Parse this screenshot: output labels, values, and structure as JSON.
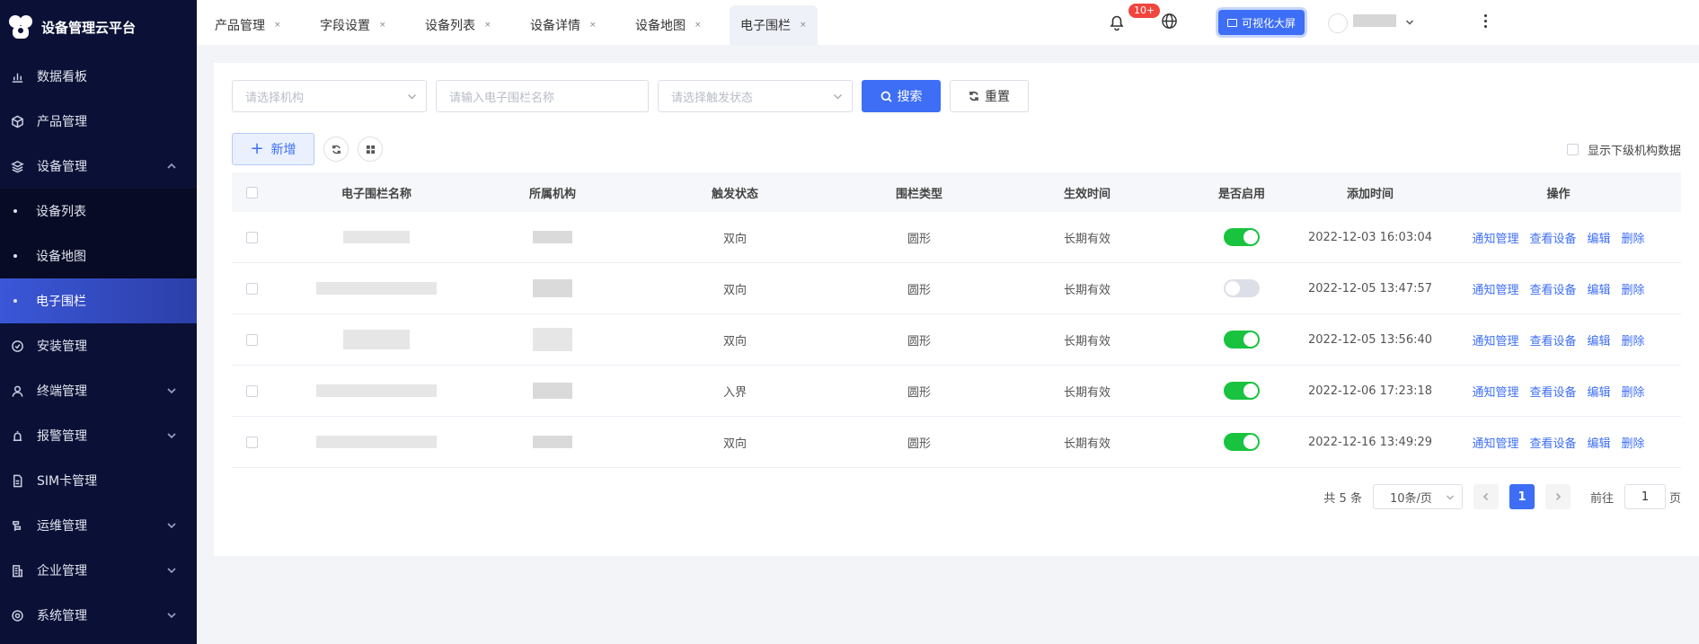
{
  "app": {
    "title": "设备管理云平台"
  },
  "sidebar": {
    "items": [
      {
        "label": "数据看板",
        "icon": "bar-chart-icon",
        "expandable": false
      },
      {
        "label": "产品管理",
        "icon": "cube-icon",
        "expandable": false
      },
      {
        "label": "设备管理",
        "icon": "layers-icon",
        "expandable": true,
        "expanded": true,
        "children": [
          {
            "label": "设备列表",
            "active": false
          },
          {
            "label": "设备地图",
            "active": false
          },
          {
            "label": "电子围栏",
            "active": true
          }
        ]
      },
      {
        "label": "安装管理",
        "icon": "check-circle-icon",
        "expandable": false
      },
      {
        "label": "终端管理",
        "icon": "user-icon",
        "expandable": true
      },
      {
        "label": "报警管理",
        "icon": "alarm-icon",
        "expandable": true
      },
      {
        "label": "SIM卡管理",
        "icon": "sim-card-icon",
        "expandable": false
      },
      {
        "label": "运维管理",
        "icon": "tool-icon",
        "expandable": true
      },
      {
        "label": "企业管理",
        "icon": "building-icon",
        "expandable": true
      },
      {
        "label": "系统管理",
        "icon": "gear-icon",
        "expandable": true
      }
    ]
  },
  "tabs": [
    {
      "label": "产品管理",
      "active": false
    },
    {
      "label": "字段设置",
      "active": false
    },
    {
      "label": "设备列表",
      "active": false
    },
    {
      "label": "设备详情",
      "active": false
    },
    {
      "label": "设备地图",
      "active": false
    },
    {
      "label": "电子围栏",
      "active": true
    }
  ],
  "tab_close_glyph": "×",
  "header": {
    "notification_badge": "10+",
    "bigscreen_label": "可视化大屏"
  },
  "filters": {
    "org_placeholder": "请选择机构",
    "name_placeholder": "请输入电子围栏名称",
    "trigger_placeholder": "请选择触发状态",
    "search_label": "搜索",
    "reset_label": "重置"
  },
  "actions": {
    "add_label": "新增",
    "show_sub_org_label": "显示下级机构数据"
  },
  "table": {
    "columns": [
      "电子围栏名称",
      "所属机构",
      "触发状态",
      "围栏类型",
      "生效时间",
      "是否启用",
      "添加时间",
      "操作"
    ],
    "rows": [
      {
        "trigger": "双向",
        "type": "圆形",
        "effective": "长期有效",
        "enabled": true,
        "added": "2022-12-03 16:03:04"
      },
      {
        "trigger": "双向",
        "type": "圆形",
        "effective": "长期有效",
        "enabled": false,
        "added": "2022-12-05 13:47:57"
      },
      {
        "trigger": "双向",
        "type": "圆形",
        "effective": "长期有效",
        "enabled": true,
        "added": "2022-12-05 13:56:40"
      },
      {
        "trigger": "入界",
        "type": "圆形",
        "effective": "长期有效",
        "enabled": true,
        "added": "2022-12-06 17:23:18"
      },
      {
        "trigger": "双向",
        "type": "圆形",
        "effective": "长期有效",
        "enabled": true,
        "added": "2022-12-16 13:49:29"
      }
    ],
    "row_actions": [
      "通知管理",
      "查看设备",
      "编辑",
      "删除"
    ]
  },
  "pagination": {
    "total_label": "共 5 条",
    "page_size": "10条/页",
    "current_page": "1",
    "goto_prefix": "前往",
    "goto_value": "1",
    "goto_suffix": "页"
  },
  "colors": {
    "sidebar_bg": "#0b1136",
    "accent": "#3d6ef5",
    "switch_on": "#19c33f",
    "badge": "#f0463e"
  }
}
